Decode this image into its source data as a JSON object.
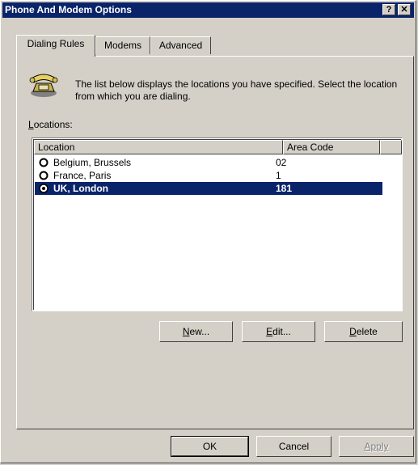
{
  "window": {
    "title": "Phone And Modem Options",
    "help_label": "?",
    "close_label": "✕"
  },
  "tabs": [
    {
      "label": "Dialing Rules",
      "active": true
    },
    {
      "label": "Modems",
      "active": false
    },
    {
      "label": "Advanced",
      "active": false
    }
  ],
  "main": {
    "icon": "telephone-icon",
    "description": "The list below displays the locations you have specified. Select the location from which you are dialing.",
    "locations_label_first": "L",
    "locations_label_rest": "ocations:"
  },
  "list": {
    "columns": [
      "Location",
      "Area Code"
    ],
    "rows": [
      {
        "name": "Belgium, Brussels",
        "code": "02",
        "selected": false
      },
      {
        "name": "France, Paris",
        "code": "1",
        "selected": false
      },
      {
        "name": "UK, London",
        "code": "181",
        "selected": true
      }
    ]
  },
  "actions": {
    "new_u": "N",
    "new_rest": "ew...",
    "edit_u": "E",
    "edit_rest": "dit...",
    "delete_u": "D",
    "delete_rest": "elete"
  },
  "footer": {
    "ok": "OK",
    "cancel": "Cancel",
    "apply": "Apply"
  },
  "colors": {
    "selection": "#0a246a",
    "face": "#d4d0c8",
    "titlebar": "#0a246a"
  }
}
